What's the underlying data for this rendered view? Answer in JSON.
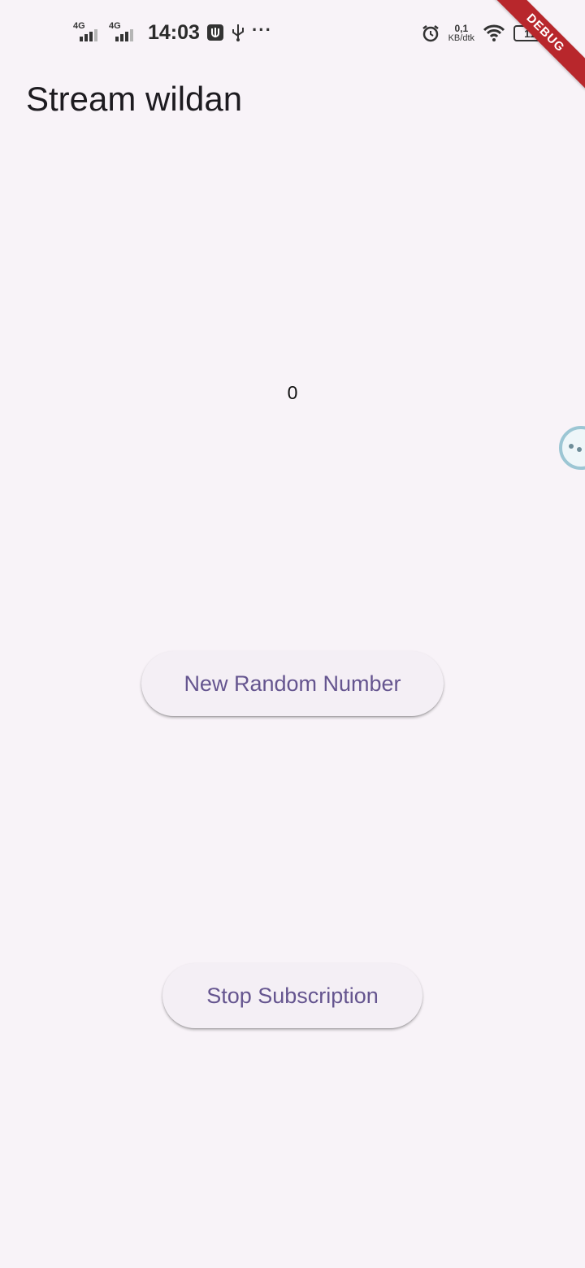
{
  "status_bar": {
    "network_1": "4G",
    "network_2": "4G",
    "time": "14:03",
    "more_indicator": "···",
    "speed_value": "0,1",
    "speed_unit": "KB/dtk",
    "battery_level": "11",
    "icons": [
      "signal-icon",
      "signal-icon",
      "usb-debug-icon",
      "usb-icon",
      "alarm-icon",
      "wifi-icon",
      "battery-icon"
    ]
  },
  "debug_banner": "DEBUG",
  "app_bar": {
    "title": "Stream wildan"
  },
  "main": {
    "number": "0",
    "new_random_button": "New Random Number",
    "stop_button": "Stop Subscription"
  },
  "colors": {
    "background": "#f8f3f8",
    "button_text": "#65558f",
    "button_bg": "#f4eff5",
    "debug_ribbon": "#b8272c"
  }
}
